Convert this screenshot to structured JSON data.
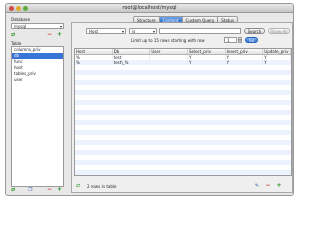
{
  "window": {
    "title": "root@localhost/mysql"
  },
  "sidebar": {
    "database_label": "Database",
    "database_value": "mysql",
    "table_label": "Table",
    "tables": [
      {
        "name": "columns_priv",
        "selected": false
      },
      {
        "name": "db",
        "selected": true
      },
      {
        "name": "func",
        "selected": false
      },
      {
        "name": "host",
        "selected": false
      },
      {
        "name": "tables_priv",
        "selected": false
      },
      {
        "name": "user",
        "selected": false
      }
    ]
  },
  "tabs": [
    {
      "label": "Structure",
      "active": false
    },
    {
      "label": "Content",
      "active": true
    },
    {
      "label": "Custom Query",
      "active": false
    },
    {
      "label": "Status",
      "active": false
    }
  ],
  "filter": {
    "column": "Host",
    "operator": "is",
    "value": "",
    "search_label": "Search",
    "show_all_label": "Show All"
  },
  "limit": {
    "label": "Limit up to 15 rows starting with row",
    "value": "1",
    "go_label": "Go"
  },
  "grid": {
    "columns": [
      "Host",
      "Db",
      "User",
      "Select_priv",
      "Insert_priv",
      "Update_priv"
    ],
    "rows": [
      [
        "%",
        "test",
        "",
        "Y",
        "Y",
        "Y"
      ],
      [
        "%",
        "test\\_%",
        "",
        "Y",
        "Y",
        "Y"
      ]
    ]
  },
  "status": {
    "rows_label": "2 rows in table"
  },
  "icons": {
    "refresh": "refresh-icon",
    "add": "plus-icon",
    "remove": "minus-icon",
    "duplicate": "duplicate-icon",
    "edit": "edit-icon"
  },
  "colors": {
    "accent": "#3875d7",
    "add": "#1a8f1a",
    "remove": "#c62828"
  }
}
